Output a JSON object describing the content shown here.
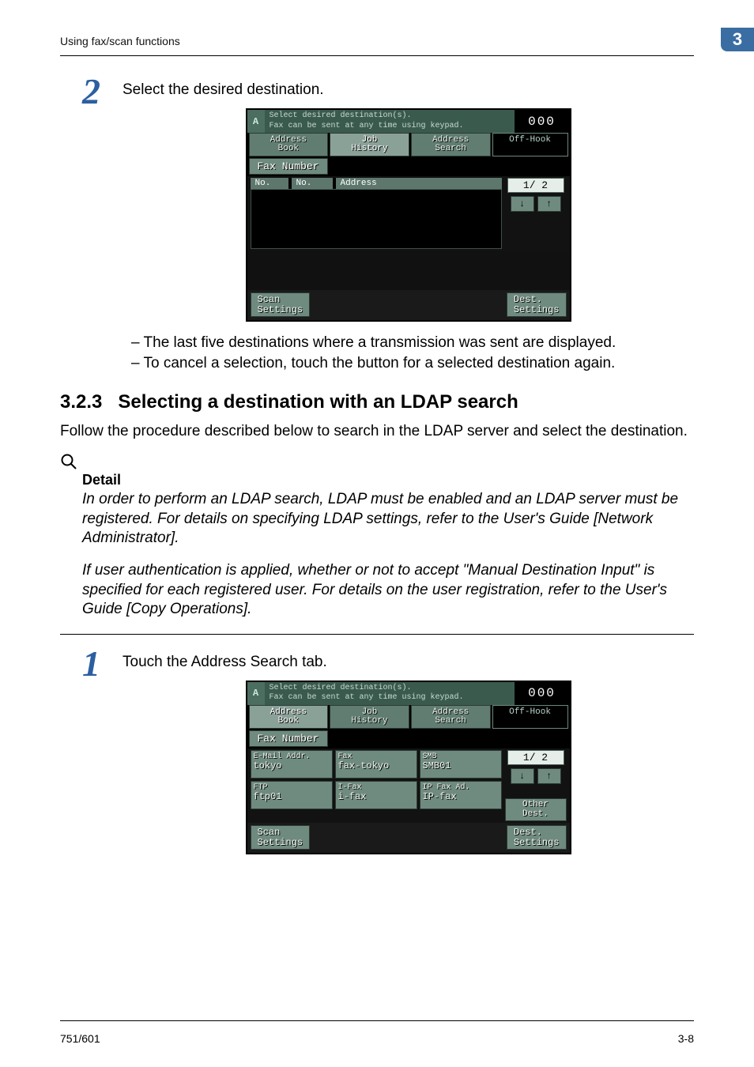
{
  "header": {
    "section_path": "Using fax/scan functions",
    "chapter_number": "3"
  },
  "step2": {
    "number": "2",
    "text": "Select the desired destination.",
    "notes": [
      "The last five destinations where a transmission was sent are displayed.",
      "To cancel a selection, touch the button for a selected destination again."
    ]
  },
  "screen1": {
    "title_line1": "Select desired destination(s).",
    "title_line2": "Fax can be sent at any time using keypad.",
    "counter": "000",
    "tabs": {
      "address_book": "Address\nBook",
      "job_history": "Job\nHistory",
      "address_search": "Address\nSearch",
      "off_hook": "Off-Hook"
    },
    "fax_number_tab": "Fax Number",
    "list_headers": {
      "c1": "No.",
      "c2": "No.",
      "c3": "Address"
    },
    "page_indicator": "1/  2",
    "scan_settings": "Scan\nSettings",
    "dest_settings": "Dest.\nSettings"
  },
  "section": {
    "heading_no": "3.2.3",
    "heading_text": "Selecting a destination with an LDAP search",
    "intro": "Follow the procedure described below to search in the LDAP server and select the destination."
  },
  "detail": {
    "label": "Detail",
    "p1": "In order to perform an LDAP search, LDAP must be enabled and an LDAP server must be registered. For details on specifying LDAP settings, refer to the User's Guide [Network Administrator].",
    "p2": "If user authentication is applied, whether or not to accept \"Manual Destination Input\" is specified for each registered user. For details on the user registration, refer to the User's Guide [Copy Operations]."
  },
  "step1b": {
    "number": "1",
    "text": "Touch the Address Search tab."
  },
  "screen2": {
    "title_line1": "Select desired destination(s).",
    "title_line2": "Fax can be sent at any time using keypad.",
    "counter": "000",
    "tabs": {
      "address_book": "Address\nBook",
      "job_history": "Job\nHistory",
      "address_search": "Address\nSearch",
      "off_hook": "Off-Hook"
    },
    "fax_number_tab": "Fax Number",
    "dest": [
      {
        "type": "E-Mail Addr.",
        "name": "tokyo"
      },
      {
        "type": "Fax",
        "name": "fax-tokyo"
      },
      {
        "type": "SMB",
        "name": "SMB01"
      },
      {
        "type": "FTP",
        "name": "ftp01"
      },
      {
        "type": "I-Fax",
        "name": "i-fax"
      },
      {
        "type": "IP Fax Ad.",
        "name": "IP-fax"
      }
    ],
    "page_indicator": "1/  2",
    "other_dest": "Other\nDest.",
    "scan_settings": "Scan\nSettings",
    "dest_settings": "Dest.\nSettings"
  },
  "footer": {
    "left": "751/601",
    "right": "3-8"
  }
}
